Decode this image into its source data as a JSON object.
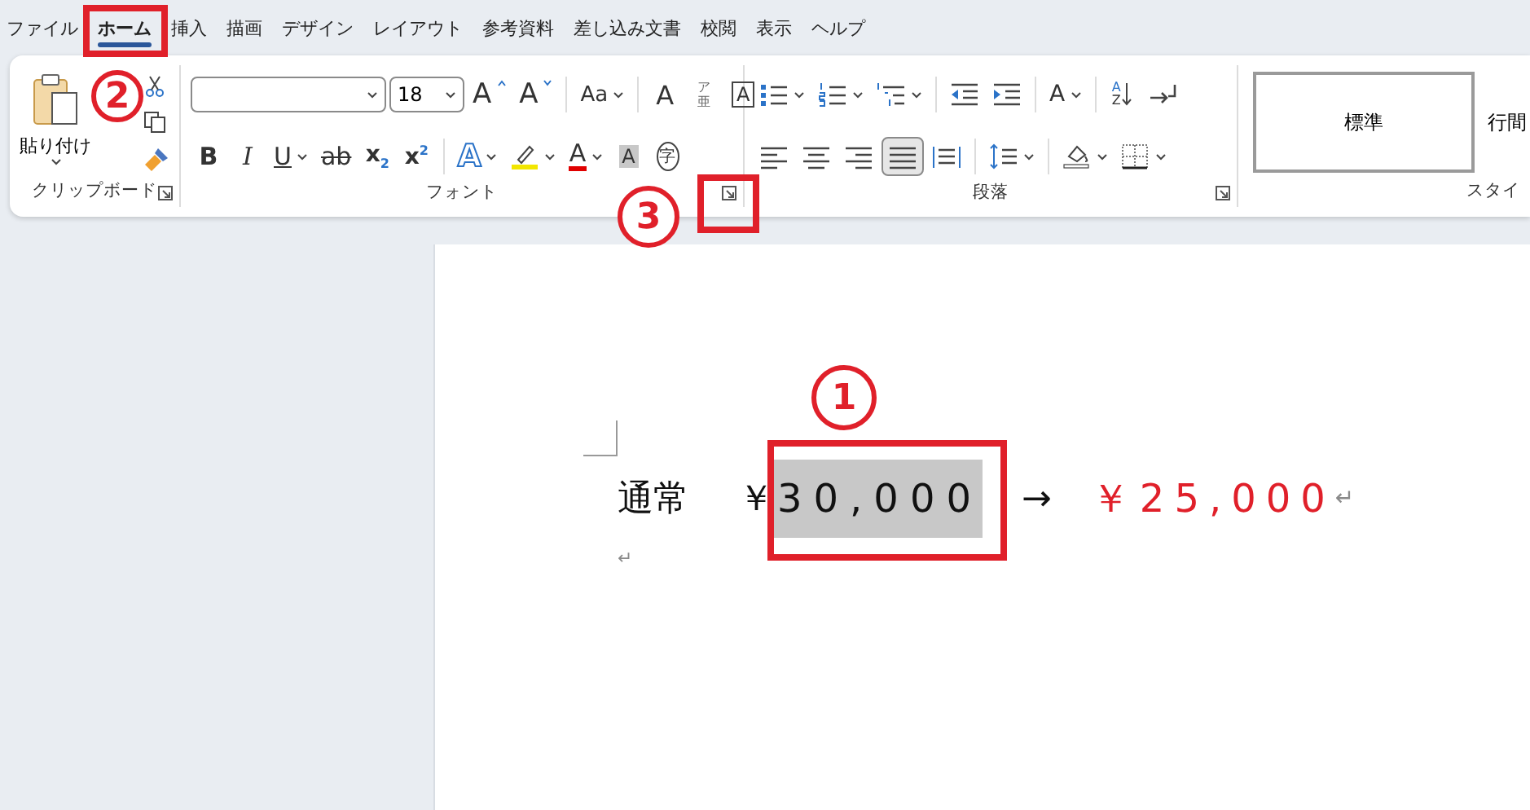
{
  "menu": [
    {
      "label": "ファイル",
      "selected": false
    },
    {
      "label": "ホーム",
      "selected": true
    },
    {
      "label": "挿入",
      "selected": false
    },
    {
      "label": "描画",
      "selected": false
    },
    {
      "label": "デザイン",
      "selected": false
    },
    {
      "label": "レイアウト",
      "selected": false
    },
    {
      "label": "参考資料",
      "selected": false
    },
    {
      "label": "差し込み文書",
      "selected": false
    },
    {
      "label": "校閲",
      "selected": false
    },
    {
      "label": "表示",
      "selected": false
    },
    {
      "label": "ヘルプ",
      "selected": false
    }
  ],
  "clipboard": {
    "paste_label": "貼り付け",
    "group_label": "クリップボード"
  },
  "font": {
    "font_size": "18",
    "group_label": "フォント",
    "row1": [
      {
        "kind": "grow",
        "label": "A",
        "dropdown": false
      },
      {
        "kind": "shrink",
        "label": "A",
        "dropdown": false
      },
      {
        "kind": "case",
        "label": "Aa",
        "dropdown": true
      },
      {
        "kind": "clear",
        "label": "A",
        "dropdown": false
      },
      {
        "kind": "phonetic",
        "label": "亜",
        "ruby": "ア",
        "dropdown": false
      },
      {
        "kind": "boxed",
        "label": "A",
        "dropdown": false
      }
    ],
    "row2": [
      {
        "kind": "bold",
        "label": "B",
        "dropdown": false
      },
      {
        "kind": "italic",
        "label": "I",
        "dropdown": false
      },
      {
        "kind": "underline",
        "label": "U",
        "dropdown": true
      },
      {
        "kind": "strike",
        "label": "ab",
        "dropdown": false
      },
      {
        "kind": "subscript",
        "label": "x",
        "script": "2",
        "dropdown": false
      },
      {
        "kind": "superscript",
        "label": "x",
        "script": "2",
        "dropdown": false
      },
      {
        "kind": "effects",
        "label": "A",
        "dropdown": true
      },
      {
        "kind": "highlight",
        "dropdown": true
      },
      {
        "kind": "color",
        "label": "A",
        "dropdown": true
      },
      {
        "kind": "shade",
        "label": "A",
        "dropdown": false
      },
      {
        "kind": "enclose",
        "label": "字",
        "dropdown": false
      }
    ]
  },
  "paragraph": {
    "group_label": "段落",
    "row1": [
      {
        "kind": "bullets",
        "dropdown": true
      },
      {
        "kind": "numbering",
        "dropdown": true
      },
      {
        "kind": "multilevel",
        "dropdown": true
      },
      {
        "kind": "outdent",
        "dropdown": false
      },
      {
        "kind": "indent",
        "dropdown": false
      },
      {
        "kind": "spacing",
        "label": "A",
        "dropdown": true
      },
      {
        "kind": "sort",
        "label": "A",
        "label2": "Z",
        "dropdown": false
      },
      {
        "kind": "marks",
        "dropdown": false
      }
    ],
    "row2": [
      {
        "kind": "left",
        "dropdown": false,
        "selected": false
      },
      {
        "kind": "center",
        "dropdown": false,
        "selected": false
      },
      {
        "kind": "right",
        "dropdown": false,
        "selected": false
      },
      {
        "kind": "justify",
        "dropdown": false,
        "selected": true
      },
      {
        "kind": "distribute",
        "dropdown": false,
        "selected": false
      },
      {
        "kind": "linespacing",
        "dropdown": true,
        "selected": false
      },
      {
        "kind": "fill",
        "dropdown": true,
        "selected": false
      },
      {
        "kind": "borders",
        "dropdown": true,
        "selected": false
      }
    ]
  },
  "styles": {
    "group_label": "スタイ",
    "items": [
      {
        "label": "標準",
        "selected": true
      },
      {
        "label": "行間",
        "selected": false
      }
    ]
  },
  "document": {
    "runs": [
      {
        "kind": "plain",
        "text": "通常"
      },
      {
        "kind": "plain",
        "text": "￥"
      },
      {
        "kind": "highlighted",
        "text": "30,000"
      },
      {
        "kind": "plain",
        "text": "→"
      },
      {
        "kind": "red",
        "text": "￥25,000"
      }
    ],
    "paragraph_marks": [
      "↵",
      "↵"
    ]
  },
  "annotations": [
    {
      "label": "2"
    },
    {
      "label": "3"
    },
    {
      "label": "1"
    }
  ]
}
